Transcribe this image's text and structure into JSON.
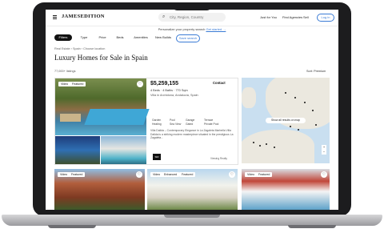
{
  "header": {
    "logo": "JAMESEDITION",
    "search_placeholder": "City, Region, Country",
    "nav": [
      "Just for You",
      "Find Agencies",
      "Sell"
    ],
    "login": "Log in"
  },
  "promo": {
    "text": "Personalize your property search",
    "link": "Get started →"
  },
  "filters": [
    "Filters",
    "Type",
    "Price",
    "Beds",
    "Amenities",
    "New Builds",
    "Save search"
  ],
  "breadcrumb": "Real Estate  ›  Spain  ›  Choose location",
  "page_title": "Luxury Homes for Sale in Spain",
  "listing_count": "77,000+ listings",
  "sort": "Sort: Premium",
  "listing": {
    "badges": [
      "Video",
      "Featured"
    ],
    "price": "$5,259,155",
    "contact": "Contact",
    "specs": "4 Beds · 4 Baths · 770 Sqm",
    "location": "Villa in Archidona, Andalucía, Spain",
    "features": [
      "Garden",
      "Pool",
      "Garage",
      "Terrace",
      "Heating",
      "Sea View",
      "Gated",
      "Private Pool",
      "Air Cond."
    ],
    "description": "Villa Dalida – Contemporary Elegance in La Zagaleta Marbella Villa Dalida is a striking modern masterpiece situated in the prestigious La Zagaleta...",
    "agency_logo": "SIR",
    "agent": "Viewing Realty"
  },
  "map": {
    "button": "Show all results on map",
    "zoom": [
      "+",
      "−"
    ]
  },
  "row2": {
    "card1_badges": [
      "Video",
      "Featured"
    ],
    "card2_badges": [
      "Video",
      "Enhanced",
      "Featured"
    ],
    "card3_badges": [
      "Video",
      "Featured"
    ]
  },
  "colors": {
    "accent": "#3a7bd5",
    "dark_chip": "#111111"
  }
}
